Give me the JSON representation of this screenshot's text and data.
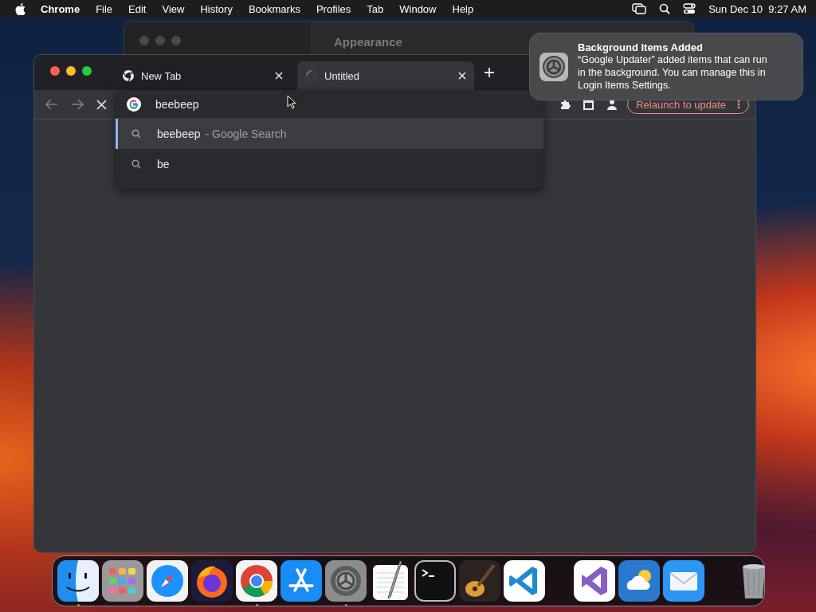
{
  "menubar": {
    "app": "Chrome",
    "menus": [
      "File",
      "Edit",
      "View",
      "History",
      "Bookmarks",
      "Profiles",
      "Tab",
      "Window",
      "Help"
    ],
    "clock": "Sun Dec 10  9:27 AM"
  },
  "background_window": {
    "title": "Appearance"
  },
  "browser": {
    "tabs": [
      {
        "title": "New Tab",
        "selected": false,
        "loading": false
      },
      {
        "title": "Untitled",
        "selected": true,
        "loading": true
      }
    ],
    "omnibox": {
      "value": "beebeep"
    },
    "suggestions": [
      {
        "query": "beebeep",
        "suffix": "- Google Search",
        "selected": true
      },
      {
        "query": "be",
        "selected": false
      }
    ],
    "relaunch_button": "Relaunch to update"
  },
  "notification": {
    "title": "Background Items Added",
    "body": "“Google Updater” added items that can run in the background. You can manage this in Login Items Settings."
  },
  "dock": {
    "apps": [
      {
        "kind": "finder",
        "running": true
      },
      {
        "kind": "launchpad",
        "running": false
      },
      {
        "kind": "safari",
        "running": false
      },
      {
        "kind": "firefox",
        "running": false
      },
      {
        "kind": "chrome",
        "running": true
      },
      {
        "kind": "appstore",
        "running": false
      },
      {
        "kind": "settings",
        "running": true
      },
      {
        "kind": "textedit",
        "running": false
      },
      {
        "kind": "terminal",
        "running": false
      },
      {
        "kind": "guitar",
        "running": false
      },
      {
        "kind": "vscode",
        "running": false
      }
    ],
    "recent": [
      {
        "kind": "visualstudio",
        "running": false
      },
      {
        "kind": "weather",
        "running": false
      },
      {
        "kind": "mail",
        "running": false
      }
    ]
  }
}
